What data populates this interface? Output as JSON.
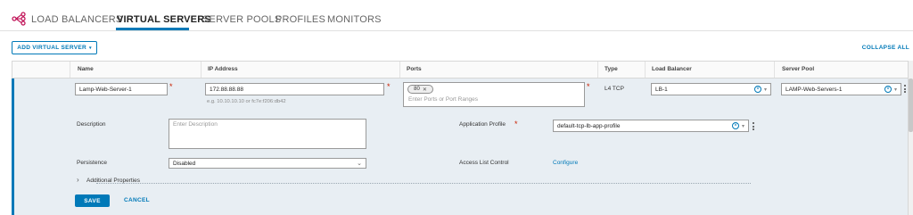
{
  "tabs": [
    {
      "label": "LOAD BALANCERS"
    },
    {
      "label": "VIRTUAL SERVERS",
      "active": true
    },
    {
      "label": "SERVER POOLS"
    },
    {
      "label": "PROFILES"
    },
    {
      "label": "MONITORS"
    }
  ],
  "toolbar": {
    "add_label": "ADD VIRTUAL SERVER",
    "collapse_label": "COLLAPSE ALL"
  },
  "table": {
    "headers": [
      "Name",
      "IP Address",
      "Ports",
      "Type",
      "Load Balancer",
      "Server Pool"
    ]
  },
  "row": {
    "name": "Lamp-Web-Server-1",
    "ip": "172.88.88.88",
    "ip_hint": "e.g. 10.10.10.10 or fc7e:f206:db42",
    "port_chip": "80",
    "ports_placeholder": "Enter Ports or Port Ranges",
    "type": "L4 TCP",
    "load_balancer": "LB-1",
    "server_pool": "LAMP-Web-Servers-1"
  },
  "details": {
    "description_label": "Description",
    "description_placeholder": "Enter Description",
    "app_profile_label": "Application Profile",
    "app_profile_value": "default-tcp-lb-app-profile",
    "persistence_label": "Persistence",
    "persistence_value": "Disabled",
    "access_list_label": "Access List Control",
    "access_list_link": "Configure",
    "additional_label": "Additional Properties"
  },
  "actions": {
    "save": "SAVE",
    "cancel": "CANCEL"
  },
  "colors": {
    "accent": "#0079b8",
    "required": "#c92100",
    "row_bg": "#e8eef3"
  }
}
